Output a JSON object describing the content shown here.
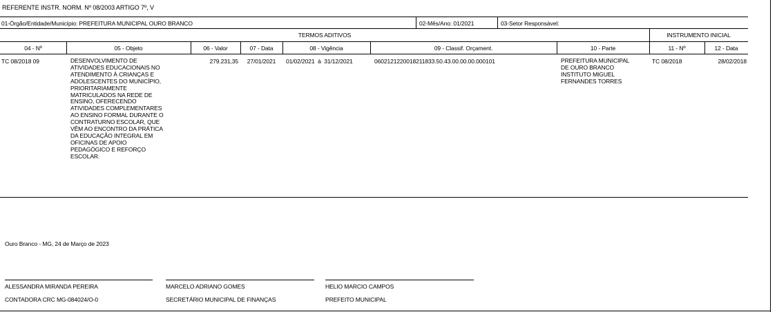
{
  "header": {
    "referente": "REFERENTE  INSTR. NORM. Nº 08/2003 ARTIGO 7º, V",
    "orgao": "01-Órgão/Entidade/Município: PREFEITURA MUNICIPAL OURO BRANCO",
    "mes_ano": "02-Mês/Ano: 01/2021",
    "setor": "03-Setor Responsável:"
  },
  "table": {
    "group_termos": "TERMOS ADITIVOS",
    "group_instrumento": "INSTRUMENTO INICIAL",
    "columns": [
      "04 - Nº",
      "05 - Objeto",
      "06 - Valor",
      "07 - Data",
      "08 - Vigência",
      "09 - Classif. Orçament.",
      "10 - Parte",
      "11 - Nº",
      "12 - Data"
    ],
    "row": {
      "numero": "TC 08/2018 09",
      "objeto": "DESENVOLVIMENTO DE\nATIVIDADES EDUCACIONAIS NO\nATENDIMENTO À CRIANÇAS E\nADOLESCENTES DO MUNICÍPIO,\nPRIORITARIAMENTE\nMATRICULADOS NA REDE DE\nENSINO, OFERECENDO\nATIVIDADES COMPLEMENTARES\nAO ENSINO FORMAL DURANTE O\nCONTRATURNO ESCOLAR, QUE\nVÊM AO ENCONTRO DA PRÁTICA\nDA EDUCAÇÃO INTEGRAL EM\nOFICINAS DE APOIO\nPEDAGÓGICO E REFORÇO\nESCOLAR.",
      "valor": "279.231,35",
      "data": "27/01/2021",
      "vigencia": "01/02/2021  à  31/12/2021",
      "classif": "0602121220018211833.50.43.00.00.00.000101",
      "parte": "PREFEITURA MUNICIPAL\nDE OURO BRANCO\nINSTITUTO MIGUEL\nFERNANDES TORRES",
      "inst_numero": "TC 08/2018",
      "inst_data": "28/02/2018"
    }
  },
  "footer": {
    "local_data": "Ouro Branco - MG,  24 de Março de 2023",
    "signatures": [
      {
        "name": "ALESSANDRA MIRANDA PEREIRA",
        "role": "CONTADORA CRC MG-084024/O-0"
      },
      {
        "name": "MARCELO ADRIANO GOMES",
        "role": "SECRETÁRIO MUNICIPAL DE FINANÇAS"
      },
      {
        "name": "HELIO MARCIO CAMPOS",
        "role": "PREFEITO MUNICIPAL"
      }
    ]
  }
}
